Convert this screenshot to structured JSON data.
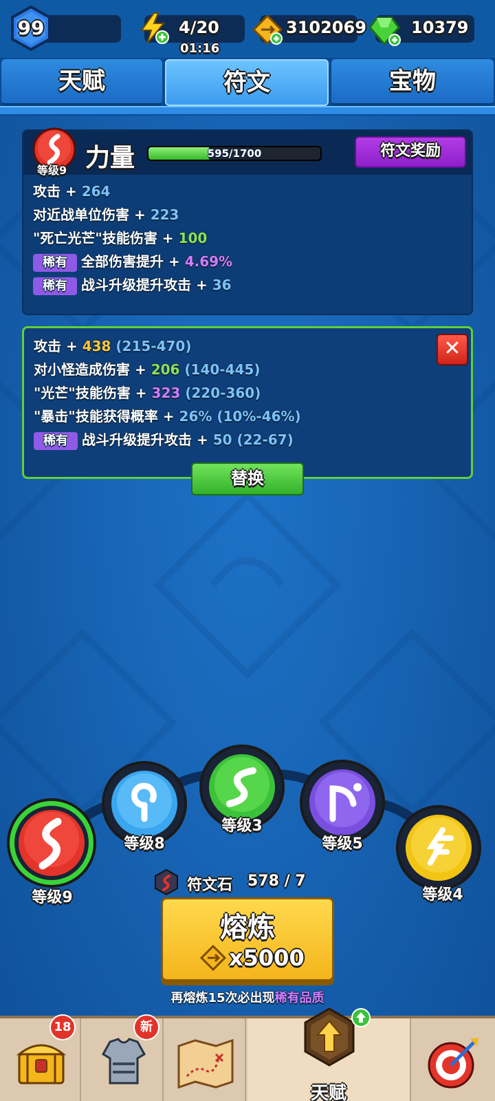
{
  "top_bar": {
    "player_level": "99",
    "energy": "4/20",
    "energy_timer": "01:16",
    "gold": "3102069",
    "gems": "10379"
  },
  "tabs": [
    {
      "label": "天赋"
    },
    {
      "label": "符文"
    },
    {
      "label": "宝物"
    }
  ],
  "active_tab": "符文",
  "current_rune": {
    "level_label": "等级9",
    "name": "力量",
    "progress_text": "595/1700",
    "progress_fraction": 0.35,
    "reward_button": "符文奖励",
    "stats": [
      {
        "label": "攻击 + ",
        "value": "264"
      },
      {
        "label": "对近战单位伤害 + ",
        "value": "223"
      },
      {
        "label": "\"死亡光芒\"技能伤害 + ",
        "value": "100"
      },
      {
        "tag": "稀有",
        "label": "全部伤害提升 + ",
        "value": "4.69%"
      },
      {
        "tag": "稀有",
        "label": "战斗升级提升攻击 + ",
        "value": "36"
      }
    ]
  },
  "new_rune": {
    "stats": [
      {
        "label": "攻击 + ",
        "value": "438",
        "range": "(215-470)"
      },
      {
        "label": "对小怪造成伤害 + ",
        "value": "206",
        "range": "(140-445)"
      },
      {
        "label": "\"光芒\"技能伤害 + ",
        "value": "323",
        "range": "(220-360)"
      },
      {
        "label": "\"暴击\"技能获得概率 + ",
        "value": "26%",
        "range": "(10%-46%)"
      },
      {
        "tag": "稀有",
        "label": "战斗升级提升攻击 + ",
        "value": "50",
        "range": "(22-67)"
      }
    ],
    "replace_button": "替换"
  },
  "rune_orbs": [
    {
      "level": "等级9",
      "color": "#e3342a"
    },
    {
      "level": "等级8",
      "color": "#3aa6f0"
    },
    {
      "level": "等级3",
      "color": "#3cc23a"
    },
    {
      "level": "等级5",
      "color": "#7a4fe0"
    },
    {
      "level": "等级4",
      "color": "#f2c414"
    }
  ],
  "runestone": {
    "label": "符文石",
    "count": "578 / 7"
  },
  "smelt": {
    "title": "熔炼",
    "cost": "x5000",
    "hint_prefix": "再熔炼15次必出现",
    "hint_highlight": "稀有品质"
  },
  "bottom_nav": {
    "chest_badge": "18",
    "armor_badge": "新",
    "talent_label": "天赋"
  }
}
